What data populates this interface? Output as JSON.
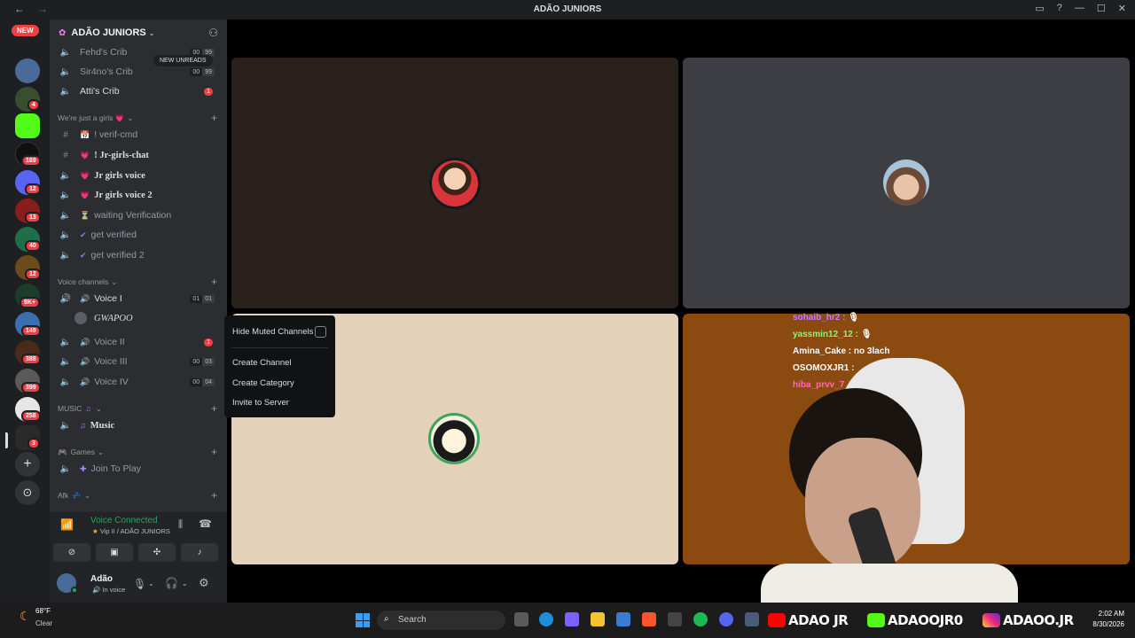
{
  "window": {
    "title": "ADÃO JUNIORS",
    "back_icon": "←",
    "forward_icon": "→"
  },
  "rail": {
    "new_badge": "NEW",
    "badges": [
      "4",
      "169",
      "12",
      "13",
      "40",
      "12",
      "9K+",
      "149",
      "388",
      "399",
      "258",
      "3"
    ]
  },
  "server": {
    "name": "ADÃO JUNIORS",
    "new_unreads": "NEW UNREADS",
    "channels_top": [
      {
        "label": "Fehd's Crib",
        "c1": "00",
        "c2": "99"
      },
      {
        "label": "Sir4no's Crib",
        "c1": "00",
        "c2": "99"
      },
      {
        "label": "Atti's Crib",
        "badge": "1"
      }
    ],
    "cat_girls": "We're just a girls 💗",
    "girls_channels": [
      {
        "label": "! verif-cmd"
      },
      {
        "label": "! Jr-girls-chat"
      },
      {
        "label": "Jr girls voice"
      },
      {
        "label": "Jr girls voice 2"
      },
      {
        "label": "waiting Verification"
      },
      {
        "label": "get verified"
      },
      {
        "label": "get verified 2"
      }
    ],
    "cat_voice": "Voice channels",
    "voice_channels": [
      {
        "label": "Voice I",
        "c1": "01",
        "c2": "01"
      },
      {
        "label": "GWAPOO"
      },
      {
        "label": "Voice II",
        "badge": "1"
      },
      {
        "label": "Voice III",
        "c1": "00",
        "c2": "03"
      },
      {
        "label": "Voice IV",
        "c1": "00",
        "c2": "04"
      }
    ],
    "cat_music": "MUSIC",
    "music_channel": "Music",
    "cat_games": "Games",
    "games_channel": "Join To Play",
    "cat_afk": "Afk"
  },
  "voice": {
    "status": "Voice Connected",
    "location": "Vip II / ADÃO JUNIORS"
  },
  "user": {
    "name": "Adão",
    "status": "In voice"
  },
  "context_menu": {
    "hide_muted": "Hide Muted Channels",
    "create_channel": "Create Channel",
    "create_category": "Create Category",
    "invite": "Invite to Server"
  },
  "chat": [
    {
      "user": "sohaib_hr2 :",
      "msg": "🎙",
      "color": "#c77dff"
    },
    {
      "user": "yassmin12_12 :",
      "msg": "🎙",
      "color": "#7cfc7c"
    },
    {
      "user": "Amina_Cake :",
      "msg": "no 3lach",
      "color": "#ffffff"
    },
    {
      "user": "OSOMOXJR1 :",
      "msg": "",
      "color": "#ffffff"
    },
    {
      "user": "hiba_prvv_7",
      "msg": "",
      "color": "#ff69b4"
    }
  ],
  "taskbar": {
    "temp": "68°F",
    "condition": "Clear",
    "search_placeholder": "Search",
    "youtube": "ADAO JR",
    "kick": "ADAOOJR0",
    "instagram": "ADAOO.JR",
    "time": "2:02 AM",
    "date": "8/30/2026"
  },
  "colors": {
    "accent_green": "#23a55a",
    "badge_red": "#f23f43",
    "tile_top_left": "#2b211c",
    "tile_top_right": "#3d3e44",
    "tile_bottom_left": "#e3d1ba",
    "tile_bottom_right": "#8b4a10"
  }
}
